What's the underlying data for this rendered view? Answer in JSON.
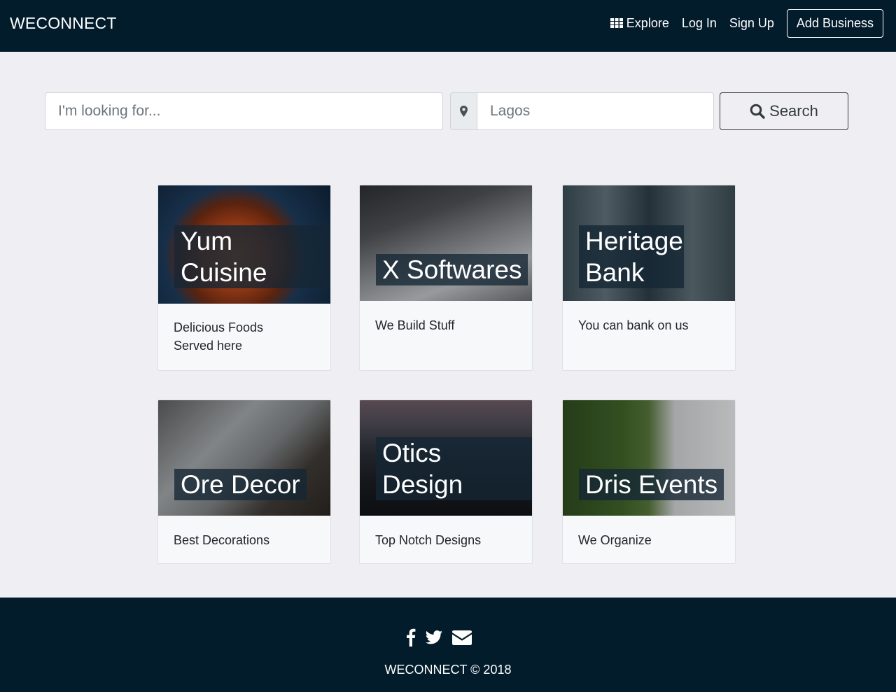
{
  "navbar": {
    "brand": "WECONNECT",
    "links": {
      "explore": "Explore",
      "login": "Log In",
      "signup": "Sign Up"
    },
    "add_business": "Add Business"
  },
  "search": {
    "keyword_placeholder": "I'm looking for...",
    "location_placeholder": "Lagos",
    "button_label": "Search",
    "location_icon": "map-marker-icon",
    "button_icon": "search-icon"
  },
  "businesses": [
    {
      "name": "Yum Cuisine",
      "tagline": "Delicious Foods Served here"
    },
    {
      "name": "X Softwares",
      "tagline": "We Build Stuff"
    },
    {
      "name": "Heritage Bank",
      "tagline": "You can bank on us"
    },
    {
      "name": "Ore Decor",
      "tagline": "Best Decorations"
    },
    {
      "name": "Otics Design",
      "tagline": "Top Notch Designs"
    },
    {
      "name": "Dris Events",
      "tagline": "We Organize"
    }
  ],
  "footer": {
    "social_icons": [
      "facebook-icon",
      "twitter-icon",
      "envelope-icon"
    ],
    "copyright": "WECONNECT © 2018"
  },
  "colors": {
    "navbar_bg": "#031c2b",
    "page_bg": "#efeff3",
    "card_bg": "#f7f8fa"
  }
}
